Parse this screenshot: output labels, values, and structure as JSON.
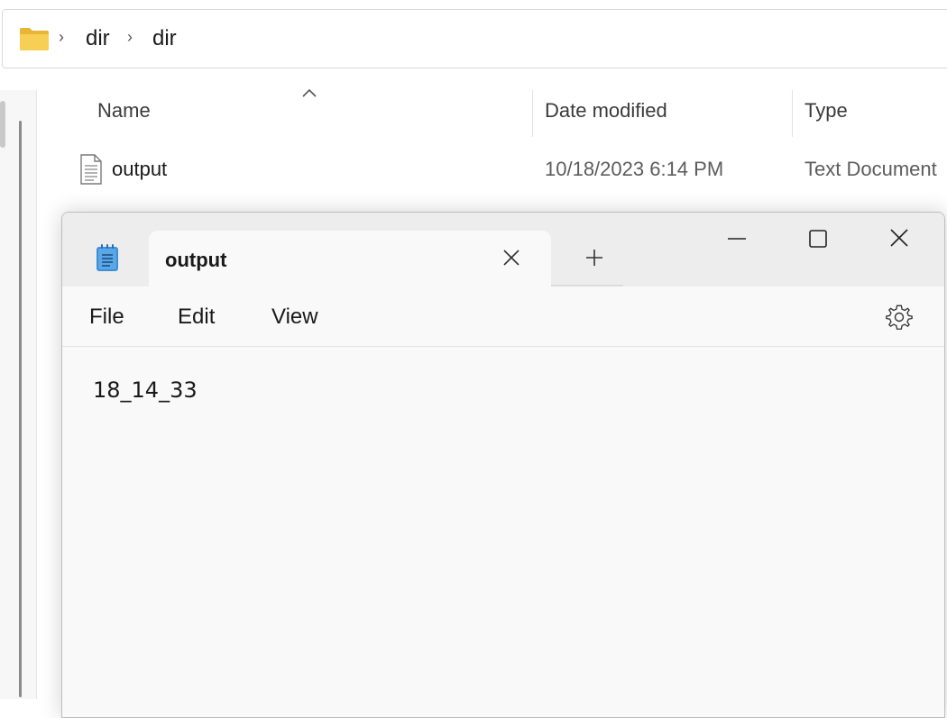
{
  "explorer": {
    "breadcrumb": [
      "dir",
      "dir"
    ],
    "columns": {
      "name": "Name",
      "date_modified": "Date modified",
      "type": "Type"
    },
    "files": [
      {
        "name": "output",
        "date_modified": "10/18/2023 6:14 PM",
        "type": "Text Document"
      }
    ]
  },
  "notepad": {
    "tab_title": "output",
    "menu": [
      "File",
      "Edit",
      "View"
    ],
    "content": "18_14_33"
  },
  "icons": {
    "folder": "folder-icon",
    "chevron": "chevron-right-icon",
    "sort": "sort-ascending-icon",
    "file": "text-file-icon",
    "notepad": "notepad-app-icon",
    "close": "close-icon",
    "plus": "plus-icon",
    "minimize": "minimize-icon",
    "maximize": "maximize-icon",
    "settings": "gear-icon"
  },
  "colors": {
    "folder": "#f3c54a",
    "notepad_icon": "#3f8fd8"
  }
}
